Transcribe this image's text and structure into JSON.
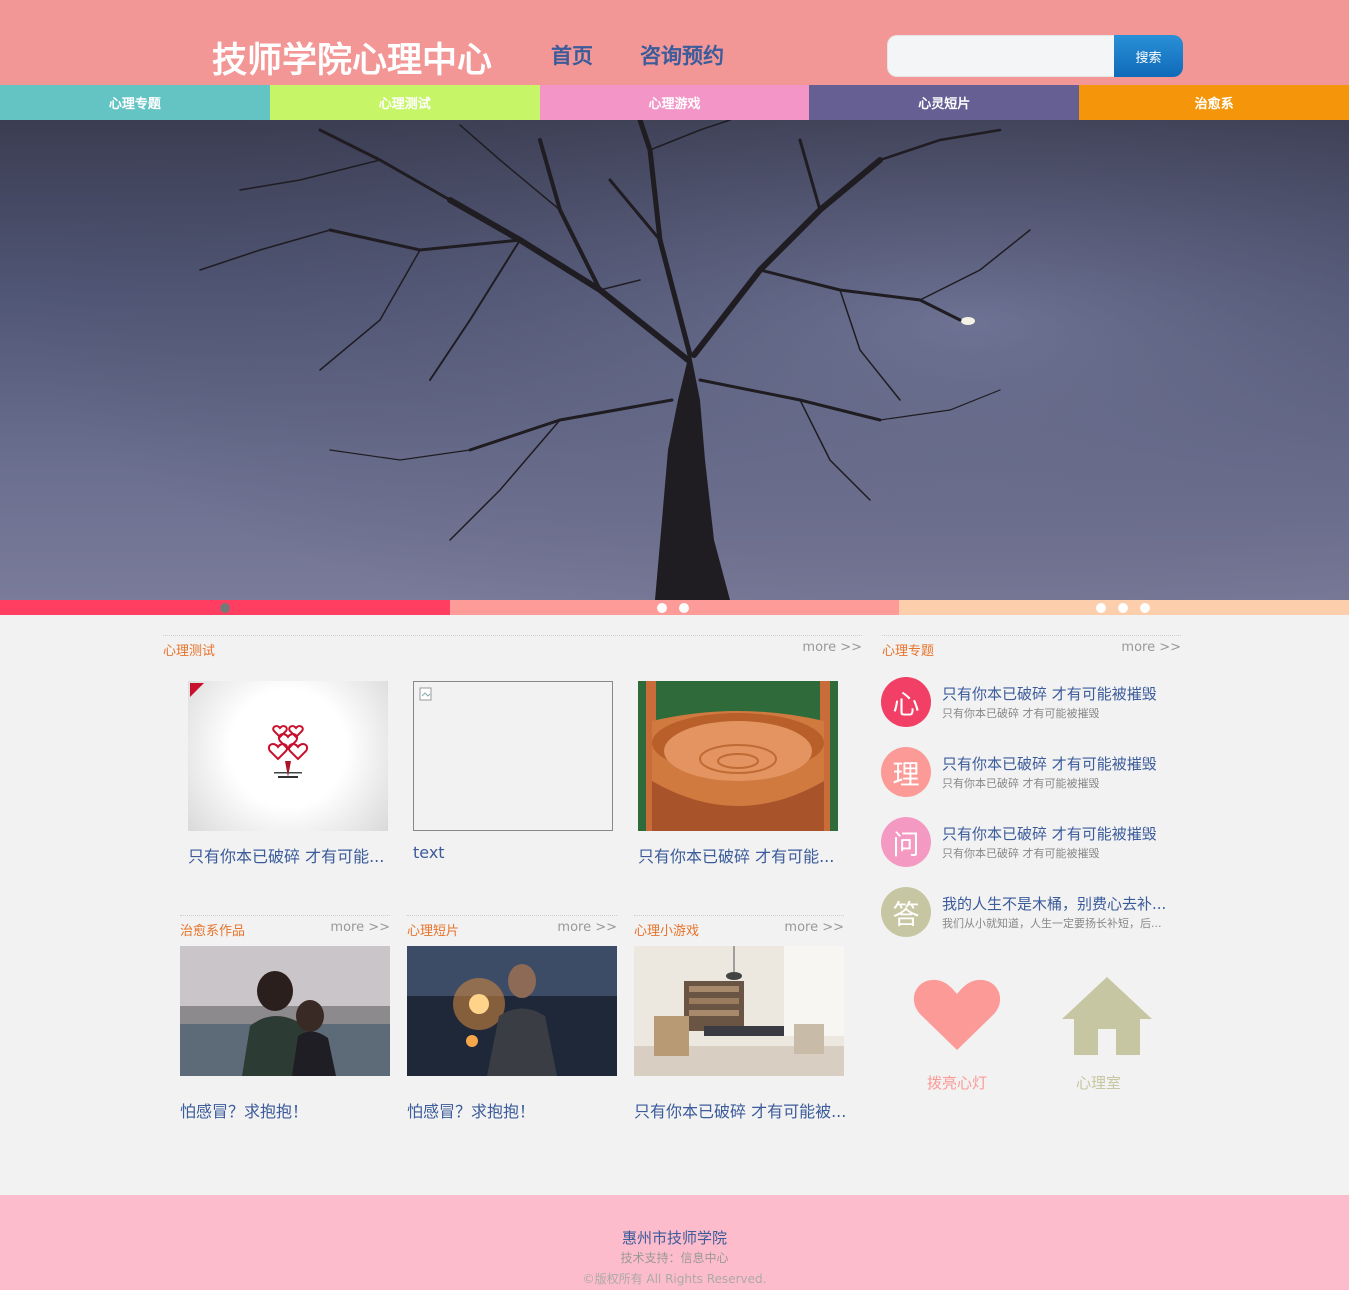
{
  "header": {
    "site_title": "技师学院心理中心",
    "nav": [
      "首页",
      "咨询预约"
    ],
    "search_placeholder": "",
    "search_button": "搜索"
  },
  "categories": [
    {
      "label": "心理专题",
      "color": "#64c3c3"
    },
    {
      "label": "心理测试",
      "color": "#c6f568"
    },
    {
      "label": "心理游戏",
      "color": "#f395c6"
    },
    {
      "label": "心灵短片",
      "color": "#655f94"
    },
    {
      "label": "治愈系",
      "color": "#f5950a"
    }
  ],
  "slider": {
    "segment_colors": [
      "#ff3e62",
      "#fd9b98",
      "#fcceab"
    ],
    "active_dot_color": "#777777"
  },
  "tests": {
    "title": "心理测试",
    "more": "more >>",
    "items": [
      {
        "caption": "只有你本已破碎 才有可能...",
        "image": "heart-tree-logo"
      },
      {
        "caption": "text",
        "image": "broken-image"
      },
      {
        "caption": "只有你本已破碎 才有可能...",
        "image": "wooden-bucket"
      }
    ]
  },
  "topics": {
    "title": "心理专题",
    "more": "more >>",
    "items": [
      {
        "char": "心",
        "color": "#f23f65",
        "title": "只有你本已破碎 才有可能被摧毁",
        "subtitle": "只有你本已破碎 才有可能被摧毁"
      },
      {
        "char": "理",
        "color": "#fb9a97",
        "title": "只有你本已破碎 才有可能被摧毁",
        "subtitle": "只有你本已破碎 才有可能被摧毁"
      },
      {
        "char": "问",
        "color": "#f49ac2",
        "title": "只有你本已破碎 才有可能被摧毁",
        "subtitle": "只有你本已破碎 才有可能被摧毁"
      },
      {
        "char": "答",
        "color": "#c7c6a2",
        "title": "我的人生不是木桶，别费心去补...",
        "subtitle": "我们从小就知道，人生一定要扬长补短，后..."
      }
    ]
  },
  "sections": [
    {
      "title": "治愈系作品",
      "more": "more >>",
      "caption": "怕感冒？求抱抱！",
      "image": "couple-hug-photo"
    },
    {
      "title": "心理短片",
      "more": "more >>",
      "caption": "怕感冒？求抱抱！",
      "image": "sparkler-photo"
    },
    {
      "title": "心理小游戏",
      "more": "more >>",
      "caption": "只有你本已破碎 才有可能被...",
      "image": "library-room-photo"
    }
  ],
  "features": [
    {
      "label": "拨亮心灯",
      "icon": "heart-icon",
      "color": "#fb9a97"
    },
    {
      "label": "心理室",
      "icon": "house-icon",
      "color": "#c7c6a2"
    }
  ],
  "footer": {
    "school": "惠州市技师学院",
    "support": "技术支持：信息中心",
    "copyright": "©版权所有 All Rights Reserved."
  }
}
